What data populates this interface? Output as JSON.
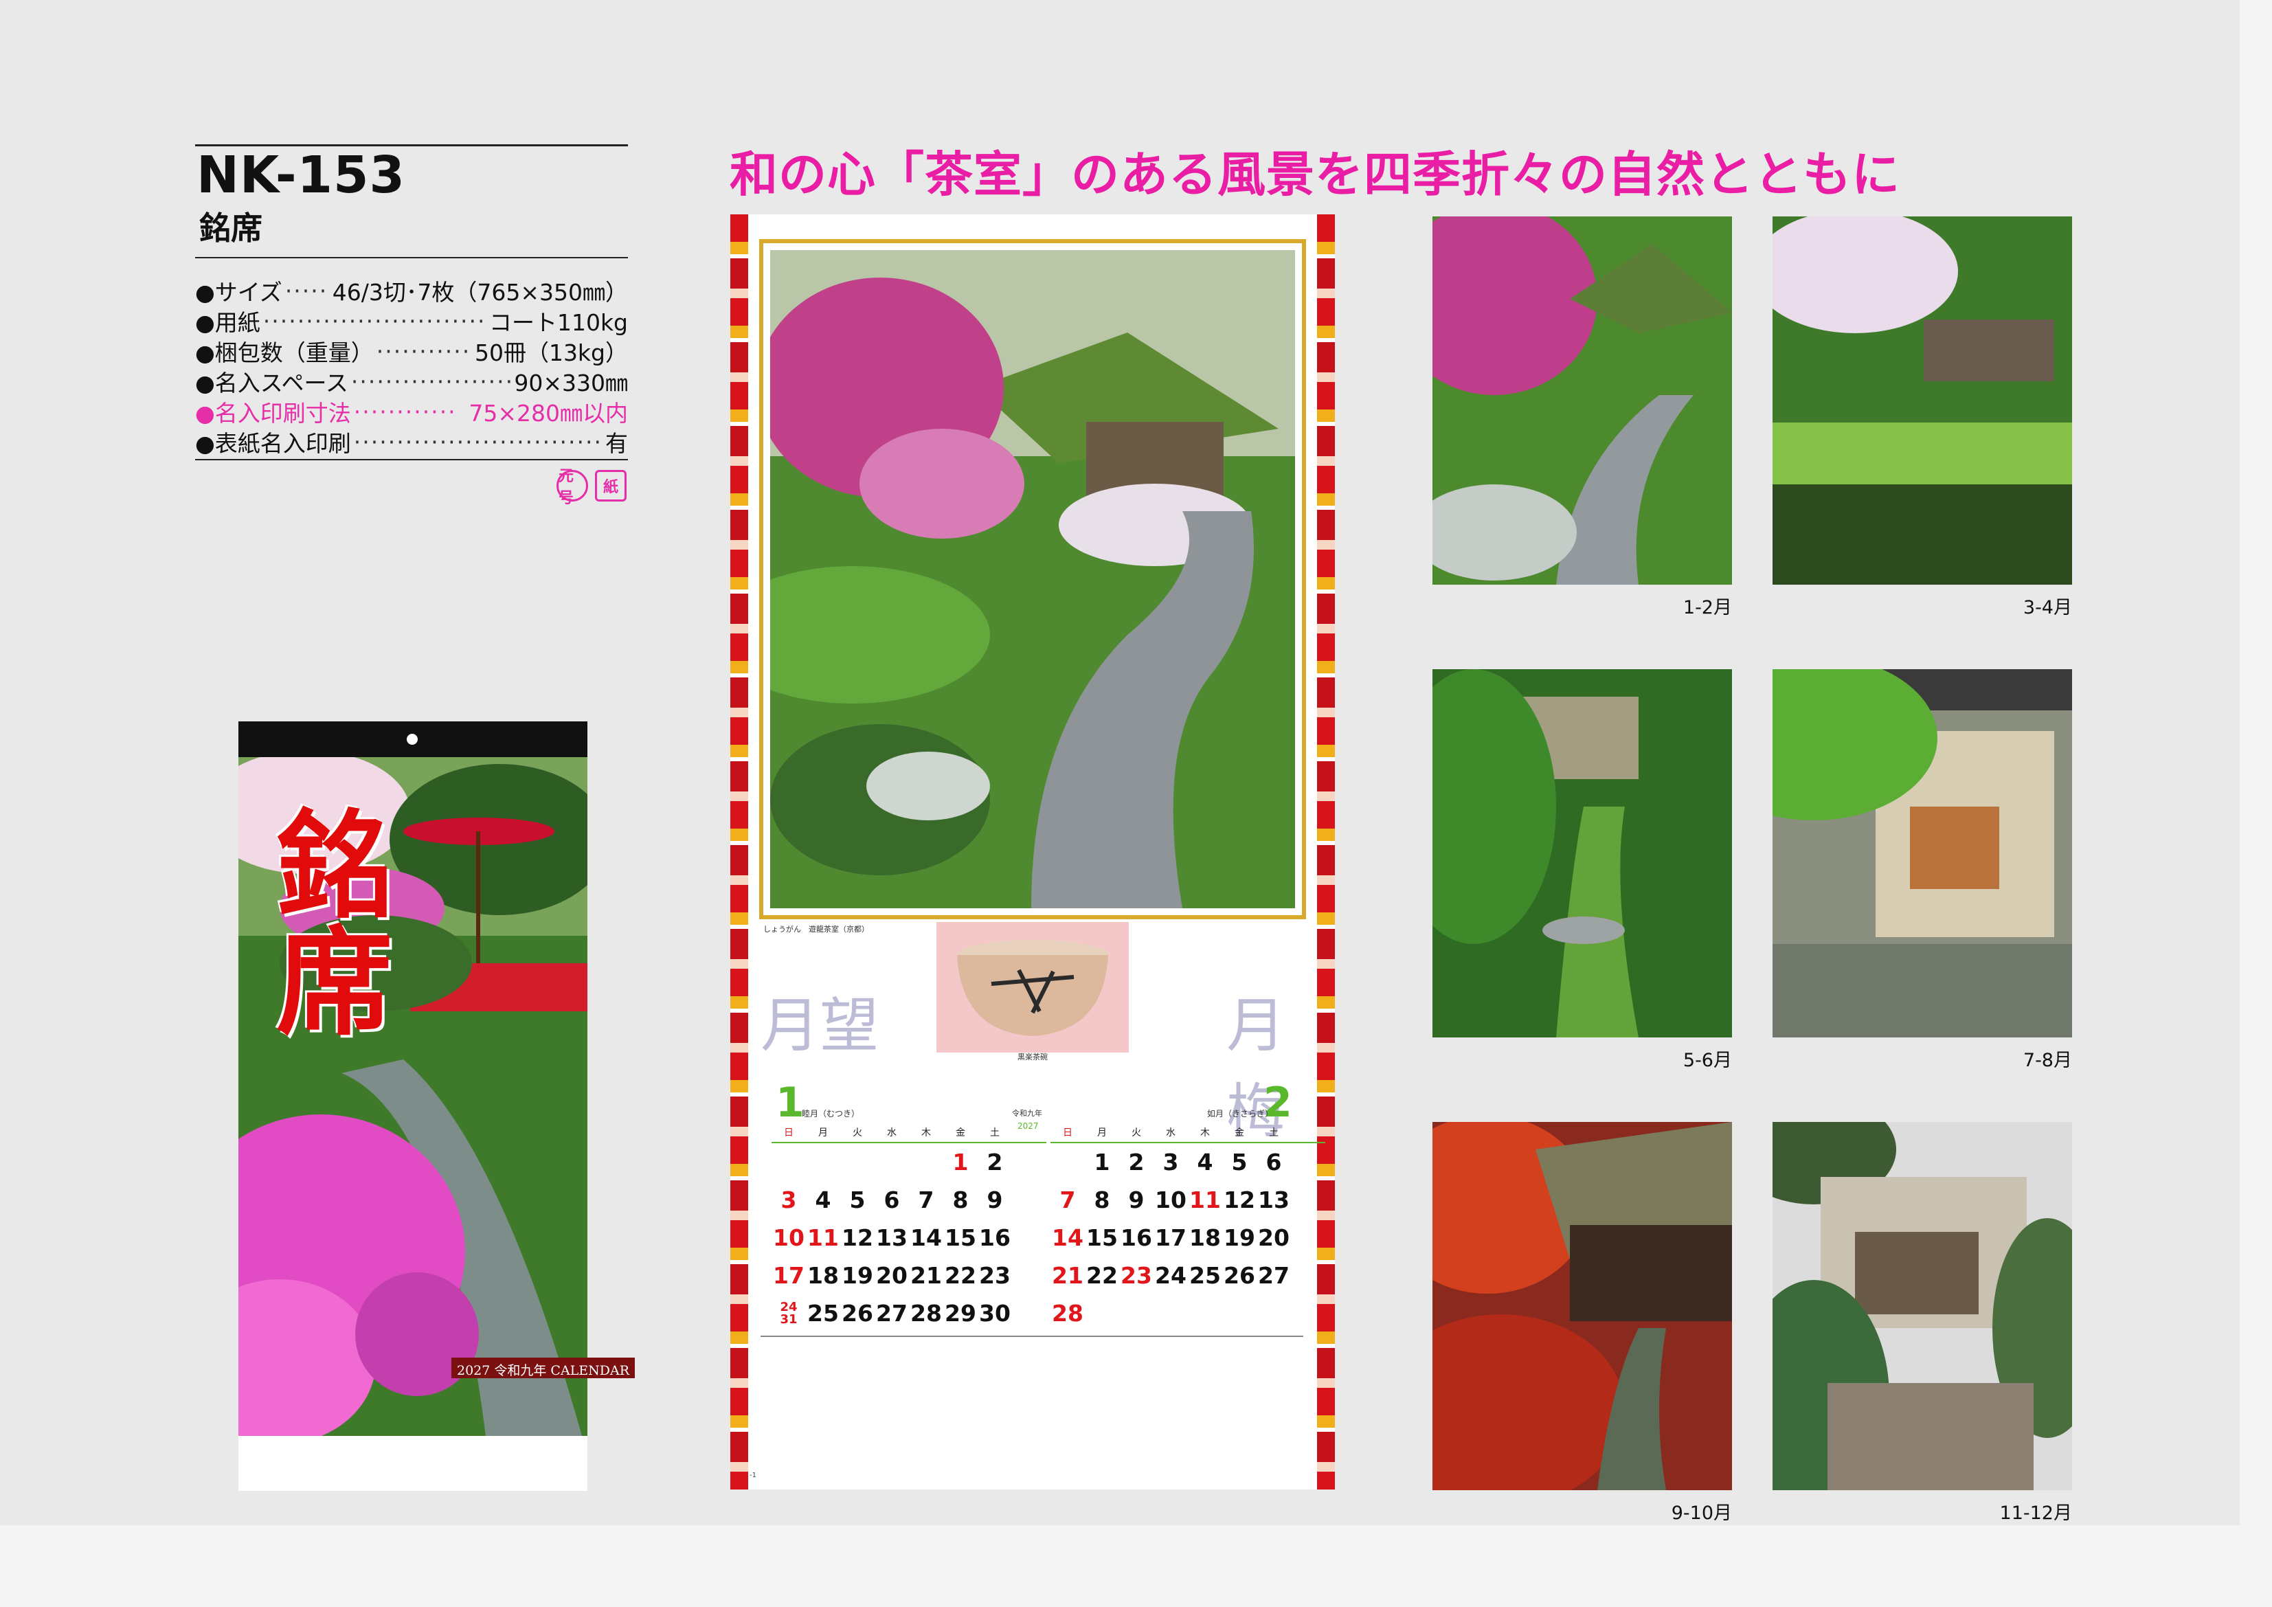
{
  "product": {
    "code": "NK-153",
    "name": "銘席",
    "specs": [
      {
        "label": "●サイズ",
        "value": "46/3切･7枚（765×350㎜）",
        "dots": "·········",
        "highlight": false
      },
      {
        "label": "●用紙",
        "value": "コート110kg",
        "dots": "·······························",
        "highlight": false
      },
      {
        "label": "●梱包数（重量）",
        "value": "50冊（13kg）",
        "dots": "·····················",
        "highlight": false
      },
      {
        "label": "●名入スペース",
        "value": "90×330㎜",
        "dots": "·····················",
        "highlight": false
      },
      {
        "label": "●名入印刷寸法",
        "value": "75×280㎜以内",
        "dots": "············",
        "highlight": true
      },
      {
        "label": "●表紙名入印刷",
        "value": "有",
        "dots": "·································",
        "highlight": false
      }
    ],
    "badges": [
      "元号",
      "紙"
    ]
  },
  "headline": "和の心「茶室」のある風景を四季折々の自然とともに",
  "cover": {
    "title": "銘席",
    "tag": "2027 令和九年 CALENDAR"
  },
  "calendar": {
    "caption": "しょうがん　遊龍茶室（京都）",
    "bowl_caption": "黒楽茶碗",
    "calligraphy_left": "月望",
    "calligraphy_right": "月梅",
    "era": "令和九年",
    "year": "2027",
    "weekdays": [
      "日",
      "月",
      "火",
      "水",
      "木",
      "金",
      "土"
    ],
    "months": [
      {
        "number": "1",
        "name": "睦月（むつき）",
        "weeks": [
          [
            "",
            "",
            "",
            "",
            "",
            "1",
            "2"
          ],
          [
            "3",
            "4",
            "5",
            "6",
            "7",
            "8",
            "9"
          ],
          [
            "10",
            "11",
            "12",
            "13",
            "14",
            "15",
            "16"
          ],
          [
            "17",
            "18",
            "19",
            "20",
            "21",
            "22",
            "23"
          ],
          [
            "24/31",
            "25",
            "26",
            "27",
            "28",
            "29",
            "30"
          ]
        ],
        "red_days": [
          "1",
          "3",
          "10",
          "11",
          "17",
          "24/31"
        ]
      },
      {
        "number": "2",
        "name": "如月（きさらぎ）",
        "weeks": [
          [
            "",
            "1",
            "2",
            "3",
            "4",
            "5",
            "6"
          ],
          [
            "7",
            "8",
            "9",
            "10",
            "11",
            "12",
            "13"
          ],
          [
            "14",
            "15",
            "16",
            "17",
            "18",
            "19",
            "20"
          ],
          [
            "21",
            "22",
            "23",
            "24",
            "25",
            "26",
            "27"
          ],
          [
            "28",
            "",
            "",
            "",
            "",
            "",
            ""
          ]
        ],
        "red_days": [
          "7",
          "11",
          "14",
          "21",
          "23",
          "28"
        ]
      }
    ],
    "page_mark": "-1"
  },
  "thumbnails": [
    {
      "label": "1-2月"
    },
    {
      "label": "3-4月"
    },
    {
      "label": "5-6月"
    },
    {
      "label": "7-8月"
    },
    {
      "label": "9-10月"
    },
    {
      "label": "11-12月"
    }
  ]
}
